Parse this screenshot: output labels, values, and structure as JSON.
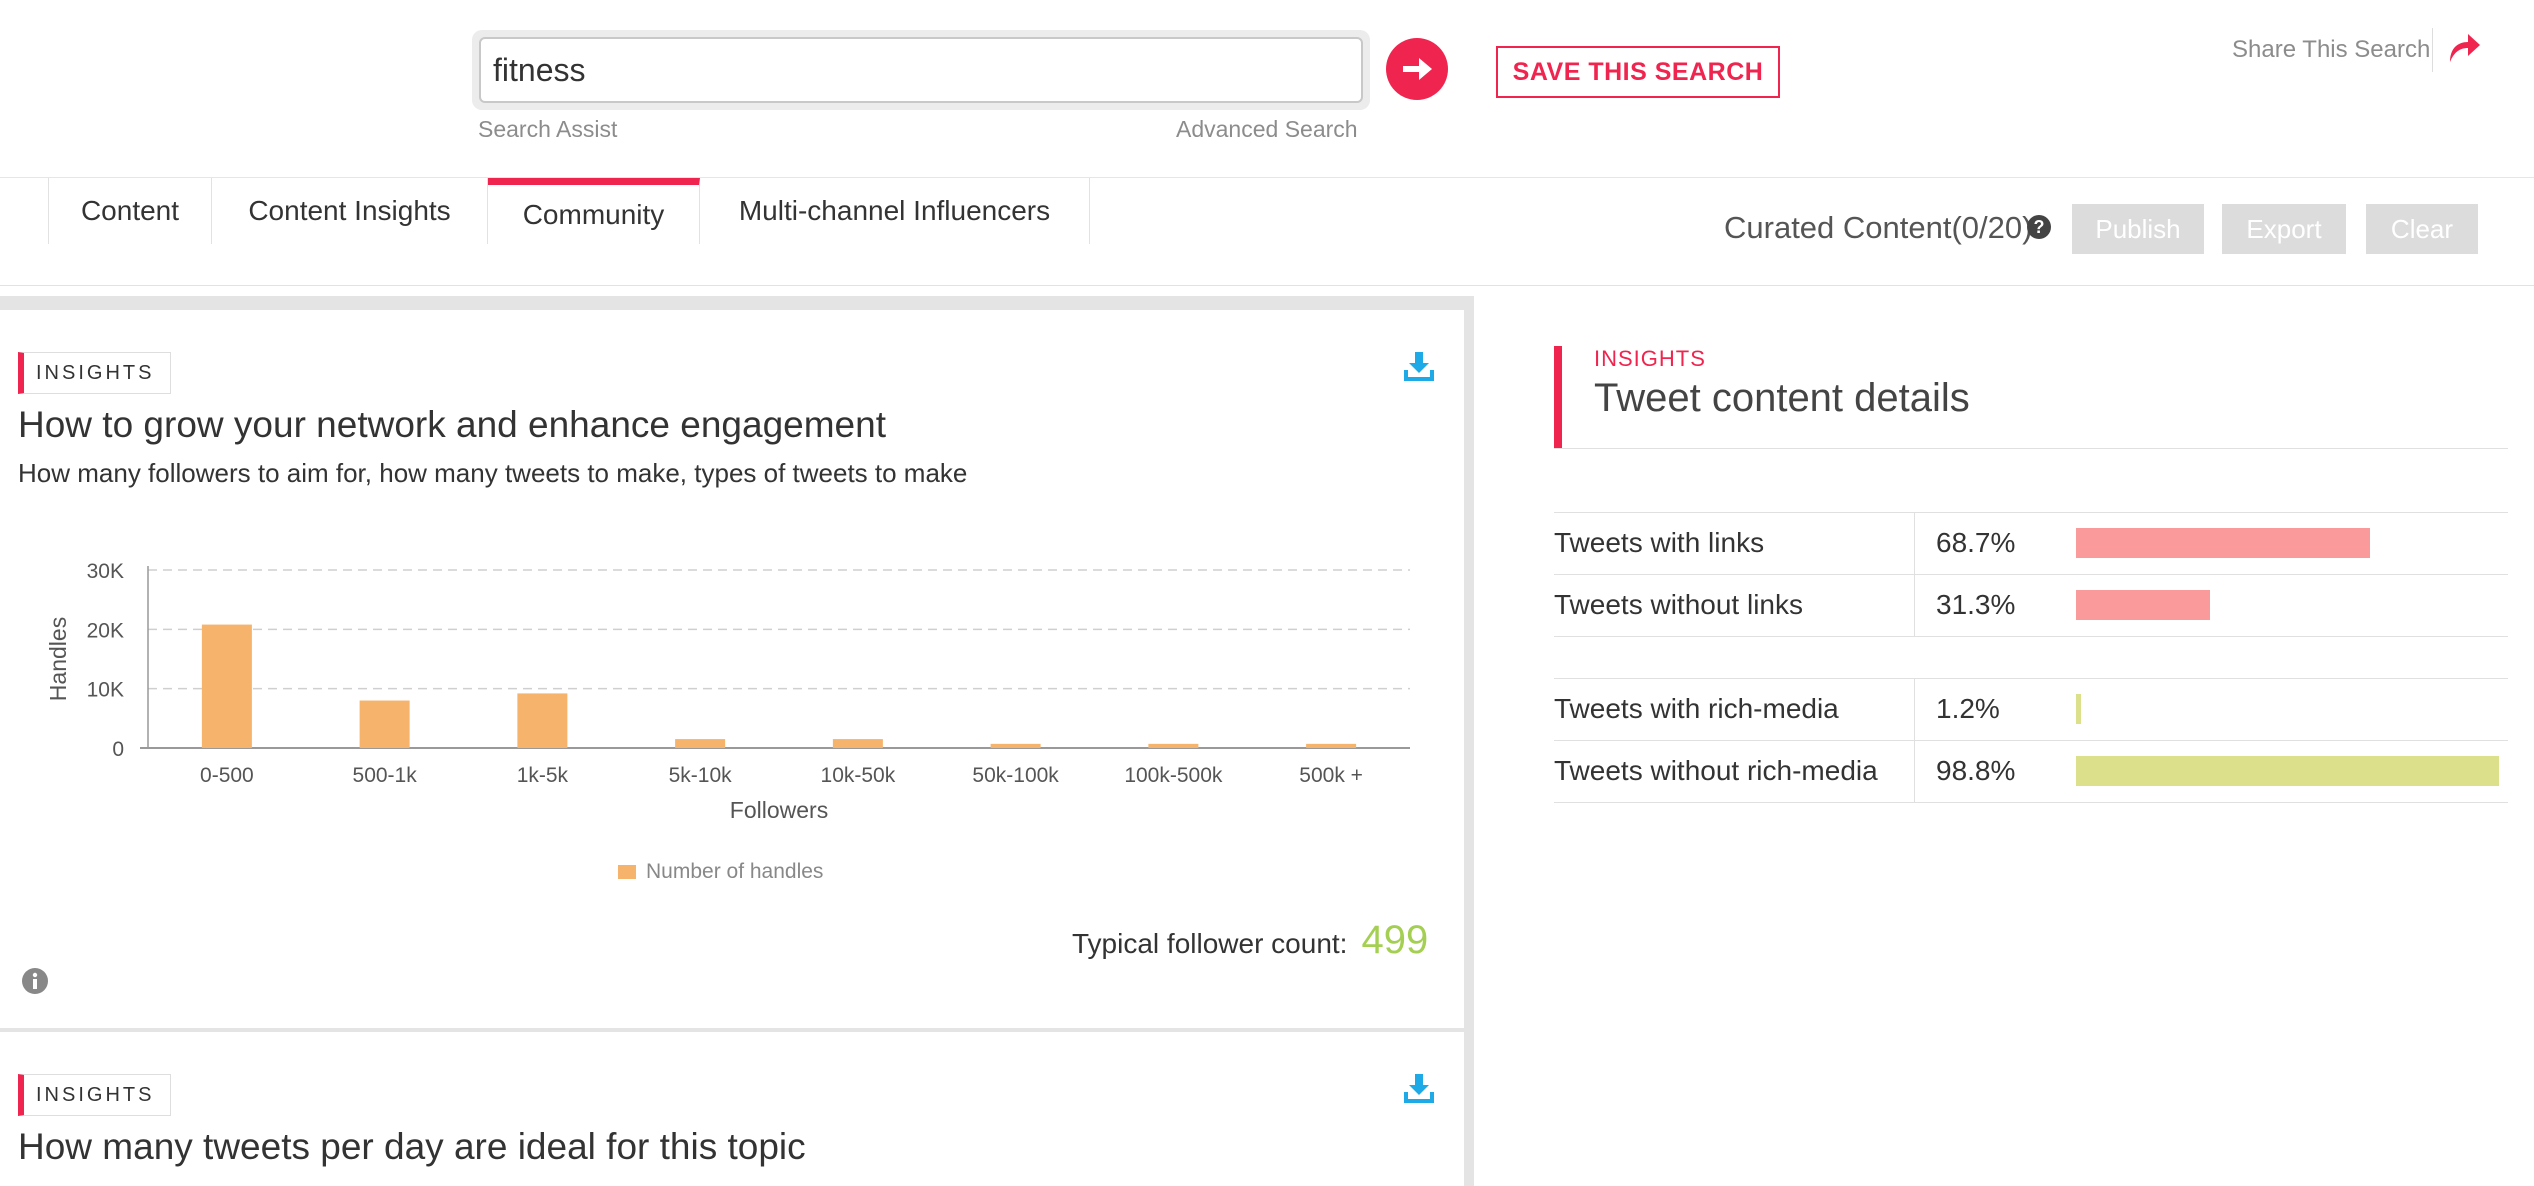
{
  "search": {
    "query": "fitness",
    "assist_label": "Search Assist",
    "advanced_label": "Advanced Search",
    "save_label": "SAVE THIS SEARCH",
    "share_label": "Share This Search"
  },
  "tabs": [
    {
      "label": "Content",
      "active": false
    },
    {
      "label": "Content Insights",
      "active": false
    },
    {
      "label": "Community",
      "active": true
    },
    {
      "label": "Multi-channel Influencers",
      "active": false
    }
  ],
  "toolbar": {
    "curated_label": "Curated Content(0/20)",
    "publish_label": "Publish",
    "export_label": "Export",
    "clear_label": "Clear"
  },
  "colors": {
    "accent": "#f0254f",
    "bar": "#f5b36b",
    "typical_value": "#a4cf52",
    "links_bar": "#fb9a9a",
    "media_bar": "#dde08a",
    "download_icon": "#1eaae7"
  },
  "cards": [
    {
      "badge": "INSIGHTS",
      "title": "How to grow your network and enhance engagement",
      "subtitle": "How many followers to aim for, how many tweets to make, types of tweets to make",
      "typical_label": "Typical follower count:",
      "typical_value": "499"
    },
    {
      "badge": "INSIGHTS",
      "title": "How many tweets per day are ideal for this topic"
    }
  ],
  "chart_data": {
    "type": "bar",
    "categories": [
      "0-500",
      "500-1k",
      "1k-5k",
      "5k-10k",
      "10k-50k",
      "50k-100k",
      "100k-500k",
      "500k +"
    ],
    "series": [
      {
        "name": "Number of handles",
        "values": [
          20800,
          8000,
          9200,
          1500,
          1500,
          700,
          700,
          700
        ]
      }
    ],
    "xlabel": "Followers",
    "ylabel": "Handles",
    "ylim": [
      0,
      30000
    ],
    "yticks": [
      0,
      10000,
      20000,
      30000
    ],
    "ytick_labels": [
      "0",
      "10K",
      "20K",
      "30K"
    ],
    "grid": true,
    "legend": "bottom-center"
  },
  "tweet_details": {
    "label": "INSIGHTS",
    "title": "Tweet content details",
    "groups": [
      {
        "color": "#fb9a9a",
        "rows": [
          {
            "label": "Tweets with links",
            "pct_text": "68.7%",
            "pct": 68.7
          },
          {
            "label": "Tweets without links",
            "pct_text": "31.3%",
            "pct": 31.3
          }
        ]
      },
      {
        "color": "#dde08a",
        "rows": [
          {
            "label": "Tweets with rich-media",
            "pct_text": "1.2%",
            "pct": 1.2
          },
          {
            "label": "Tweets without rich-media",
            "pct_text": "98.8%",
            "pct": 98.8
          }
        ]
      }
    ]
  }
}
